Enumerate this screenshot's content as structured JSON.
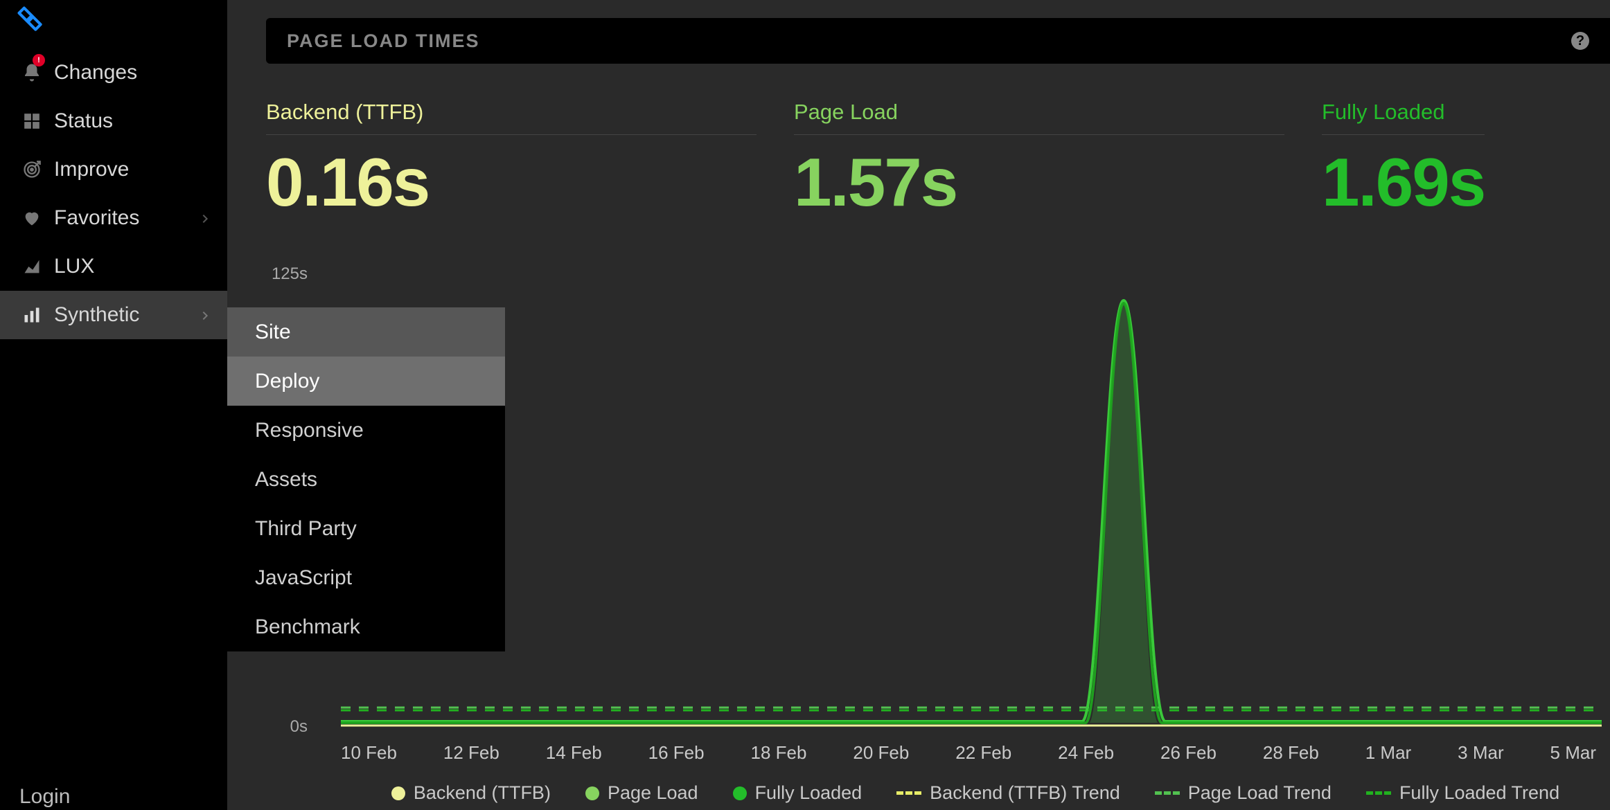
{
  "sidebar": {
    "items": [
      {
        "label": "Changes",
        "icon": "bell-icon",
        "has_chevron": false,
        "has_badge": true
      },
      {
        "label": "Status",
        "icon": "grid-icon",
        "has_chevron": false
      },
      {
        "label": "Improve",
        "icon": "target-icon",
        "has_chevron": false
      },
      {
        "label": "Favorites",
        "icon": "heart-icon",
        "has_chevron": true
      },
      {
        "label": "LUX",
        "icon": "chart-icon",
        "has_chevron": false
      },
      {
        "label": "Synthetic",
        "icon": "bars-icon",
        "has_chevron": true,
        "active": true
      }
    ],
    "login": "Login"
  },
  "submenu": {
    "items": [
      {
        "label": "Site",
        "state": "hover"
      },
      {
        "label": "Deploy",
        "state": "active"
      },
      {
        "label": "Responsive",
        "state": ""
      },
      {
        "label": "Assets",
        "state": ""
      },
      {
        "label": "Third Party",
        "state": ""
      },
      {
        "label": "JavaScript",
        "state": ""
      },
      {
        "label": "Benchmark",
        "state": ""
      }
    ]
  },
  "panel": {
    "title": "PAGE LOAD TIMES",
    "help_glyph": "?"
  },
  "metrics": [
    {
      "label": "Backend (TTFB)",
      "value": "0.16s",
      "color": "yellow"
    },
    {
      "label": "Page Load",
      "value": "1.57s",
      "color": "green"
    },
    {
      "label": "Fully Loaded",
      "value": "1.69s",
      "color": "dgreen"
    }
  ],
  "legend": [
    {
      "label": "Backend (TTFB)",
      "kind": "dot",
      "color": "yellow"
    },
    {
      "label": "Page Load",
      "kind": "dot",
      "color": "green"
    },
    {
      "label": "Fully Loaded",
      "kind": "dot",
      "color": "dgreen"
    },
    {
      "label": "Backend (TTFB) Trend",
      "kind": "dash",
      "color": "yellow"
    },
    {
      "label": "Page Load Trend",
      "kind": "dash",
      "color": "green"
    },
    {
      "label": "Fully Loaded Trend",
      "kind": "dash",
      "color": "dgreen"
    }
  ],
  "chart_data": {
    "type": "line",
    "title": "Page Load Times",
    "xlabel": "",
    "ylabel": "",
    "ylim": [
      0,
      125
    ],
    "y_unit": "s",
    "y_ticks": [
      "125s",
      "0s"
    ],
    "x_ticks": [
      "10 Feb",
      "12 Feb",
      "14 Feb",
      "16 Feb",
      "18 Feb",
      "20 Feb",
      "22 Feb",
      "24 Feb",
      "26 Feb",
      "28 Feb",
      "1 Mar",
      "3 Mar",
      "5 Mar"
    ],
    "series": [
      {
        "name": "Backend (TTFB)",
        "color": "#eef19a",
        "values": [
          0.16,
          0.16,
          0.16,
          0.16,
          0.16,
          0.16,
          0.16,
          0.16,
          0.16,
          0.16,
          0.16,
          0.16,
          0.16
        ]
      },
      {
        "name": "Page Load",
        "color": "#87d35f",
        "values": [
          1.57,
          1.57,
          1.57,
          1.57,
          1.57,
          1.57,
          1.57,
          1.57,
          120,
          1.57,
          1.57,
          1.57,
          1.57
        ]
      },
      {
        "name": "Fully Loaded",
        "color": "#23bd2a",
        "values": [
          1.69,
          1.69,
          1.69,
          1.69,
          1.69,
          1.69,
          1.69,
          1.69,
          120,
          1.69,
          1.69,
          1.69,
          1.69
        ]
      },
      {
        "name": "Backend (TTFB) Trend",
        "color": "#e7ec68",
        "dashed": true,
        "values": [
          0.16,
          0.16,
          0.16,
          0.16,
          0.16,
          0.16,
          0.16,
          0.16,
          0.16,
          0.16,
          0.16,
          0.16,
          0.16
        ]
      },
      {
        "name": "Page Load Trend",
        "color": "#52c150",
        "dashed": true,
        "values": [
          2.5,
          2.5,
          2.5,
          2.5,
          2.5,
          2.5,
          2.5,
          2.5,
          2.5,
          2.5,
          2.5,
          2.5,
          2.5
        ]
      },
      {
        "name": "Fully Loaded Trend",
        "color": "#21b21f",
        "dashed": true,
        "values": [
          2.7,
          2.7,
          2.7,
          2.7,
          2.7,
          2.7,
          2.7,
          2.7,
          2.7,
          2.7,
          2.7,
          2.7,
          2.7
        ]
      }
    ]
  }
}
